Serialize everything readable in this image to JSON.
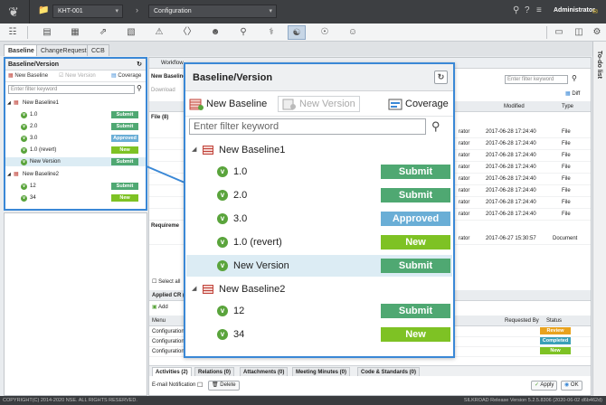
{
  "header": {
    "project": "KHT-001",
    "context": "Configuration",
    "user": "Administrator"
  },
  "tabs": [
    "Baseline",
    "ChangeRequest",
    "CCB"
  ],
  "todo_label": "To-do list",
  "status_bar": {
    "copyright": "COPYRIGHT(C) 2014-2020 NSE. ALL RIGHTS RESERVED.",
    "release": "SILKROAD Release Version 5.2.5.8306 (2020-06-02 d6b462d)"
  },
  "baseline_panel": {
    "title": "Baseline/Version",
    "tools": {
      "new_baseline": "New Baseline",
      "new_version": "New Version",
      "coverage": "Coverage"
    },
    "filter_placeholder": "Enter filter keyword",
    "baselines": [
      {
        "name": "New Baseline1",
        "versions": [
          {
            "label": "1.0",
            "status": "Submit"
          },
          {
            "label": "2.0",
            "status": "Submit"
          },
          {
            "label": "3.0",
            "status": "Approved"
          },
          {
            "label": "1.0 (revert)",
            "status": "New"
          },
          {
            "label": "New Version",
            "status": "Submit",
            "selected": true
          }
        ]
      },
      {
        "name": "New Baseline2",
        "versions": [
          {
            "label": "12",
            "status": "Submit"
          },
          {
            "label": "34",
            "status": "New"
          }
        ]
      }
    ]
  },
  "status_colors": {
    "Submit": "#4fa872",
    "Approved": "#6aaed6",
    "New": "#7ec224"
  },
  "workflow": {
    "title": "Workflow",
    "row_label": "New Baseline",
    "download": "Download",
    "filter_placeholder": "Enter filter keyword",
    "diff": "Diff",
    "columns": {
      "modified": "Modified",
      "type": "Type"
    },
    "file_group": "File (8)",
    "files": [
      {
        "who": "rator",
        "modified": "2017-06-28 17:24:40",
        "type": "File"
      },
      {
        "who": "rator",
        "modified": "2017-06-28 17:24:40",
        "type": "File"
      },
      {
        "who": "rator",
        "modified": "2017-06-28 17:24:40",
        "type": "File"
      },
      {
        "who": "rator",
        "modified": "2017-06-28 17:24:40",
        "type": "File"
      },
      {
        "who": "rator",
        "modified": "2017-06-28 17:24:40",
        "type": "File"
      },
      {
        "who": "rator",
        "modified": "2017-06-28 17:24:40",
        "type": "File"
      },
      {
        "who": "rator",
        "modified": "2017-06-28 17:24:40",
        "type": "File"
      },
      {
        "who": "rator",
        "modified": "2017-06-28 17:24:40",
        "type": "File"
      }
    ],
    "req_group": "Requireme",
    "req_row": {
      "who": "rator",
      "modified": "2017-06-27 15:30:57",
      "type": "Document"
    },
    "select_all": "Select all"
  },
  "applied_cr": {
    "title": "Applied CR (",
    "add": "Add",
    "columns": {
      "menu": "Menu",
      "requested_by": "Requested By",
      "status": "Status"
    },
    "rows": [
      {
        "menu": "Configuration",
        "status": "Review",
        "color": "#e8a21e"
      },
      {
        "menu": "Configuration",
        "status": "Completed",
        "color": "#3aa0b8"
      },
      {
        "menu": "Configuration",
        "status": "New",
        "color": "#7ec224"
      }
    ]
  },
  "bottom_tabs": [
    "Activities (2)",
    "Relations (0)",
    "Attachments (0)",
    "Meeting Minutes (0)",
    "Code & Standards (0)"
  ],
  "bottom_bar": {
    "email_label": "E-mail Notification",
    "delete": "Delete",
    "apply": "Apply",
    "ok": "OK"
  }
}
